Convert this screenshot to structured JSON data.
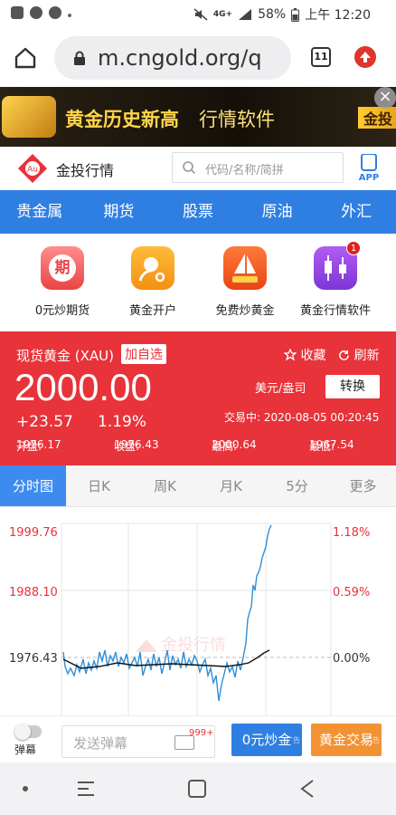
{
  "status_bar": {
    "battery": "58%",
    "clock": "上午 12:20",
    "network": "4G+"
  },
  "browser": {
    "url": "m.cngold.org/q",
    "tab_count": "11"
  },
  "banner": {
    "headline": "黄金历史新高",
    "subline": "行情软件",
    "tag": "金投",
    "close_symbol": "×"
  },
  "site": {
    "title": "金投行情",
    "logo_text": "Au",
    "search_placeholder": "代码/名称/简拼",
    "app_label": "APP"
  },
  "nav": {
    "items": [
      "贵金属",
      "期货",
      "股票",
      "原油",
      "外汇"
    ]
  },
  "promos": [
    {
      "label": "0元炒期货",
      "icon": "futures-icon",
      "color": "#f06a6a",
      "glyph": "期"
    },
    {
      "label": "黄金开户",
      "icon": "account-open-icon",
      "color": "#f7a21b",
      "glyph": ""
    },
    {
      "label": "免费炒黄金",
      "icon": "sailboat-icon",
      "color": "#f2561f",
      "glyph": ""
    },
    {
      "label": "黄金行情软件",
      "icon": "candlestick-app-icon",
      "color": "#9b4de3",
      "glyph": "",
      "badge": "1"
    }
  ],
  "quote": {
    "name": "现货黄金 (XAU)",
    "add_watch": "加自选",
    "favorite": "收藏",
    "refresh": "刷新",
    "price": "2000.00",
    "unit": "美元/盎司",
    "switch": "转换",
    "change": "+23.57",
    "change_pct": "1.19%",
    "time_label": "交易中:",
    "time": "2020-08-05 00:20:45",
    "open_label": "开盘:",
    "open": "1976.17",
    "close_label": "收盘:",
    "close": "1976.43",
    "high_label": "最高:",
    "high": "2000.64",
    "low_label": "最低:",
    "low": "1967.54",
    "color": "#e8333a"
  },
  "timeframes": {
    "items": [
      "分时图",
      "日K",
      "周K",
      "月K",
      "5分",
      "更多"
    ],
    "active": 0
  },
  "chart": {
    "y_labels_left": [
      "1999.76",
      "1988.10",
      "1976.43"
    ],
    "y_labels_right": [
      "1.18%",
      "0.59%",
      "0.00%"
    ],
    "watermark": "金投行情",
    "line_color": "#2f8fd8",
    "avg_color": "#111111"
  },
  "bottom_bar": {
    "toggle_label": "弹幕",
    "danmu_placeholder": "发送弹幕",
    "message_count": "999+",
    "btn_futures": "0元炒金",
    "btn_gold_trade": "黄金交易",
    "ad_tag": "广告"
  }
}
